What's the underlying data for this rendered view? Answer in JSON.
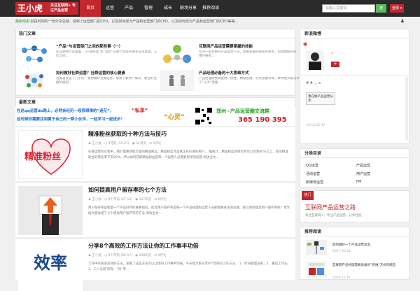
{
  "header": {
    "logo": "王小虎",
    "slogan": "关注互联网+ 专注产品运营",
    "nav": [
      "首页",
      "运营",
      "产品",
      "管理",
      "成长",
      "职场分享",
      "推荐阅读"
    ],
    "search_placeholder": "请输入关键词",
    "search_btn": "搜",
    "user_btn": "登录 ▾"
  },
  "ticker": {
    "tag": "最新动态:",
    "text": "前段时间的一份分享总结，说到了运营部门的CEO，以及如何成为产品和运营部门的CEO，以及如何成为产品和运营部门的CEO等等..."
  },
  "featured": {
    "title": "热门文章",
    "items": [
      {
        "title": "“产品”与运营部门之间的那些事（一）",
        "desc": "在互联网行业里面，“产品经理”和“运营”这两个岗位的关系非常紧密，它们之间..."
      },
      {
        "title": "互联网产品运营需要掌握的技能",
        "desc": "作为一名合格的产品运营人员，需要掌握的技能有很多，包括数据分析、用户研究..."
      },
      {
        "title": "如何做好社群运营？社群运营的核心要素",
        "desc": "社群运营是一门学问，要想做好社群运营，需要了解用户需求，建立好社群的规则..."
      },
      {
        "title": "产品经理必备的十大思维方式",
        "desc": "产品经理需要具备用户思维、数据思维、迭代思维等等，本文给大家分享了“十大”思维..."
      }
    ]
  },
  "latest": {
    "title": "最新文章"
  },
  "banner": {
    "line1": "在这qq运营de路上，必然会经历一段很艰难的“迷茫”，",
    "line2": "这时候你需要找到属于自己的一群小伙伴，一起学习一起进步！",
    "highlight1": "“私享”",
    "highlight2": "“心灵”",
    "right1": "郑州~产品运营圈交流群",
    "right2": "365 190 395"
  },
  "posts": [
    {
      "title": "精准粉丝获取的十种方法与技巧",
      "thumb": "精准粉丝",
      "author": "王小虎",
      "date": "3月前 (10-07)",
      "views": "31浏览",
      "comments": "0评论",
      "excerpt": "在做运营的过程中，我们需要获取大量的精准粉丝，精准粉丝才是真正有价值的用户。 据统计，精准粉丝的转化率可以达到80%以上，而非精准粉丝的转化率不到20%。所以如何获取精准粉丝是每一个运营人员需要思考的问题 阅读全文..."
    },
    {
      "title": "如何提高用户留存率的七个方法",
      "thumb": "",
      "author": "王小虎",
      "date": "4个月前 (07-15)",
      "views": "157浏览",
      "comments": "0评论",
      "excerpt": "用户留存率是衡量一个产品好坏的重要指标，提高用户留存率是每一个产品经理和运营人员都需要关注的问题。那么如何提高用户留存率呢？本文给大家总结了七个提高用户留存率的方法 阅读全文..."
    },
    {
      "title": "分享8个高效的工作方法让你的工作事半功倍",
      "thumb": "效率",
      "author": "王小虎",
      "date": "5个月前 (06-17)",
      "views": "208浏览",
      "comments": "0评论",
      "excerpt": "工作中有很多高效的方法，掌握了这些方法可以让你的工作事半功倍。今天给大家分享8个高效的工作方法， 1、时间管理法则；2、番茄工作法；3、二八法则 等等，“效”率..."
    }
  ],
  "side": {
    "weibo_title": "新浪微博",
    "weibo_badge": "V",
    "follow": "+",
    "weibo_text": "# # … x",
    "weibo_bubble": "我在做产品运营分享",
    "weibo_time": "10-15 02:17",
    "cat_title": "分类目录",
    "cats": [
      "QQ运营",
      "产品运营",
      "活动运营",
      "用户运营",
      "新媒体运营",
      "FM"
    ],
    "hot_tag": "热门",
    "hot_title": "互联网产品运营之路",
    "hot_desc": "关注互联网+，专注产品运营，分享经验。",
    "rec_title": "推荐阅读",
    "recs": [
      {
        "title": "如何做好一个产品运营总监",
        "date": "2017-03-21"
      },
      {
        "title": "互联网产品经理需要具备的“思维”方式有哪些",
        "date": "2016-11-11"
      }
    ]
  },
  "colors": {
    "brand": "#c1272d",
    "green": "#5cb85c",
    "dark": "#2b2b2b"
  }
}
